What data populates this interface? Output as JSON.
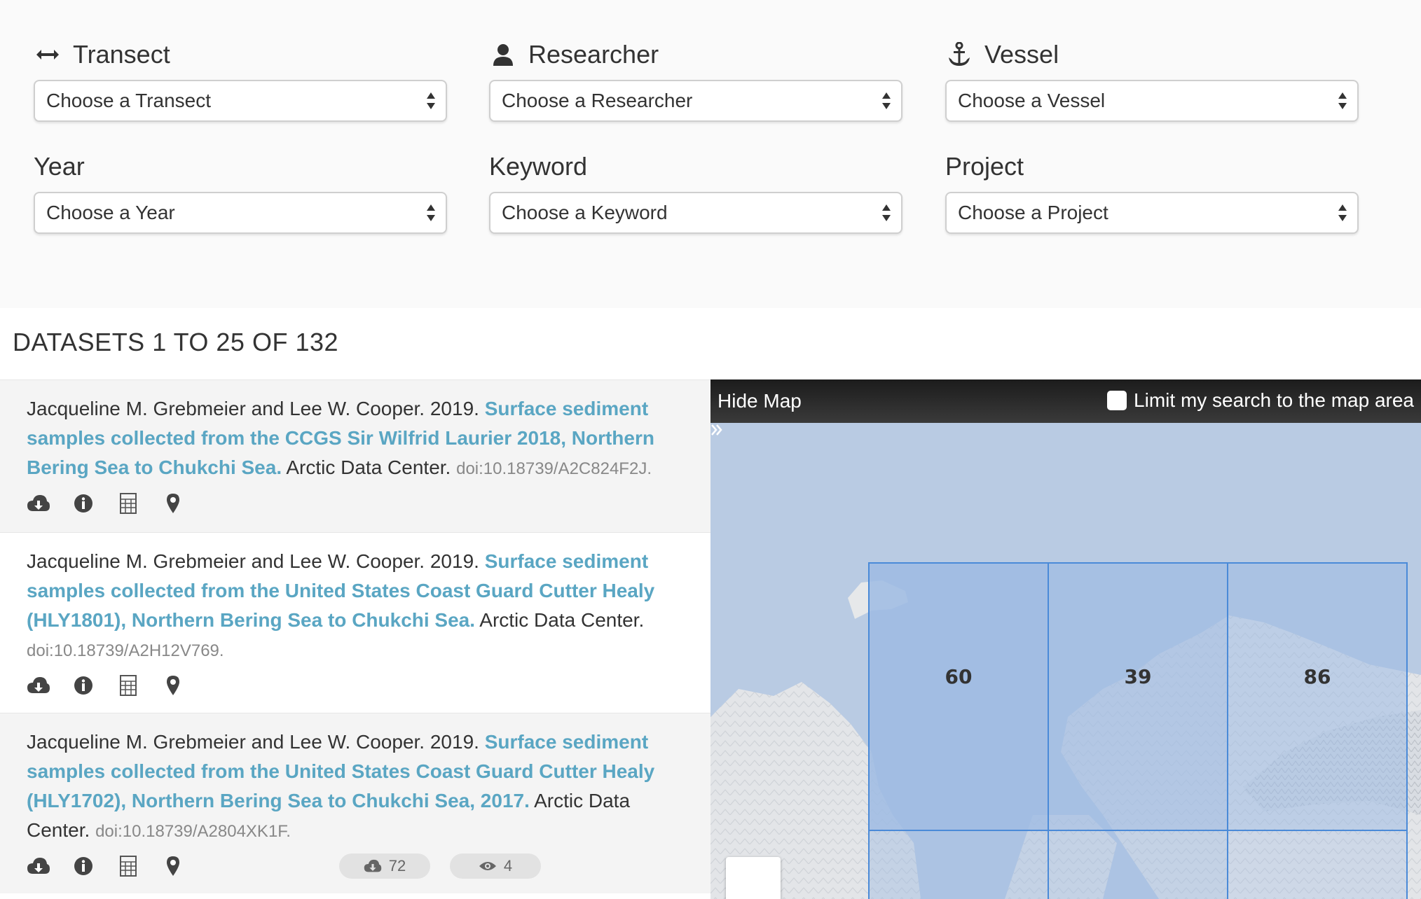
{
  "filters": {
    "transect": {
      "label": "Transect",
      "placeholder": "Choose a Transect",
      "icon": "arrows-h-icon"
    },
    "researcher": {
      "label": "Researcher",
      "placeholder": "Choose a Researcher",
      "icon": "user-icon"
    },
    "vessel": {
      "label": "Vessel",
      "placeholder": "Choose a Vessel",
      "icon": "anchor-icon"
    },
    "year": {
      "label": "Year",
      "placeholder": "Choose a Year"
    },
    "keyword": {
      "label": "Keyword",
      "placeholder": "Choose a Keyword"
    },
    "project": {
      "label": "Project",
      "placeholder": "Choose a Project"
    }
  },
  "results": {
    "heading": "DATASETS 1 TO 25 OF 132",
    "items": [
      {
        "authors": "Jacqueline M. Grebmeier and Lee W. Cooper. 2019.",
        "title": "Surface sediment samples collected from the CCGS Sir Wilfrid Laurier 2018, Northern Bering Sea to Chukchi Sea.",
        "publisher": "Arctic Data Center.",
        "doi": "doi:10.18739/A2C824F2J."
      },
      {
        "authors": "Jacqueline M. Grebmeier and Lee W. Cooper. 2019.",
        "title": "Surface sediment samples collected from the United States Coast Guard Cutter Healy (HLY1801), Northern Bering Sea to Chukchi Sea.",
        "publisher": "Arctic Data Center.",
        "doi": "doi:10.18739/A2H12V769."
      },
      {
        "authors": "Jacqueline M. Grebmeier and Lee W. Cooper. 2019.",
        "title": "Surface sediment samples collected from the United States Coast Guard Cutter Healy (HLY1702), Northern Bering Sea to Chukchi Sea, 2017.",
        "publisher": "Arctic Data Center.",
        "doi": "doi:10.18739/A2804XK1F.",
        "downloads": "72",
        "views": "4"
      }
    ]
  },
  "map": {
    "hide_label": "Hide Map",
    "limit_label": "Limit my search to the map area",
    "cells": [
      "60",
      "39",
      "86"
    ],
    "zoom_in": "+",
    "colors": {
      "water": "#b9cbe3",
      "cell_fill": "#9ebbe3",
      "cell_border": "#4a8ad8",
      "land": "#e4e6e8"
    }
  },
  "theme": {
    "link": "#5aa6c3",
    "text": "#333333"
  }
}
